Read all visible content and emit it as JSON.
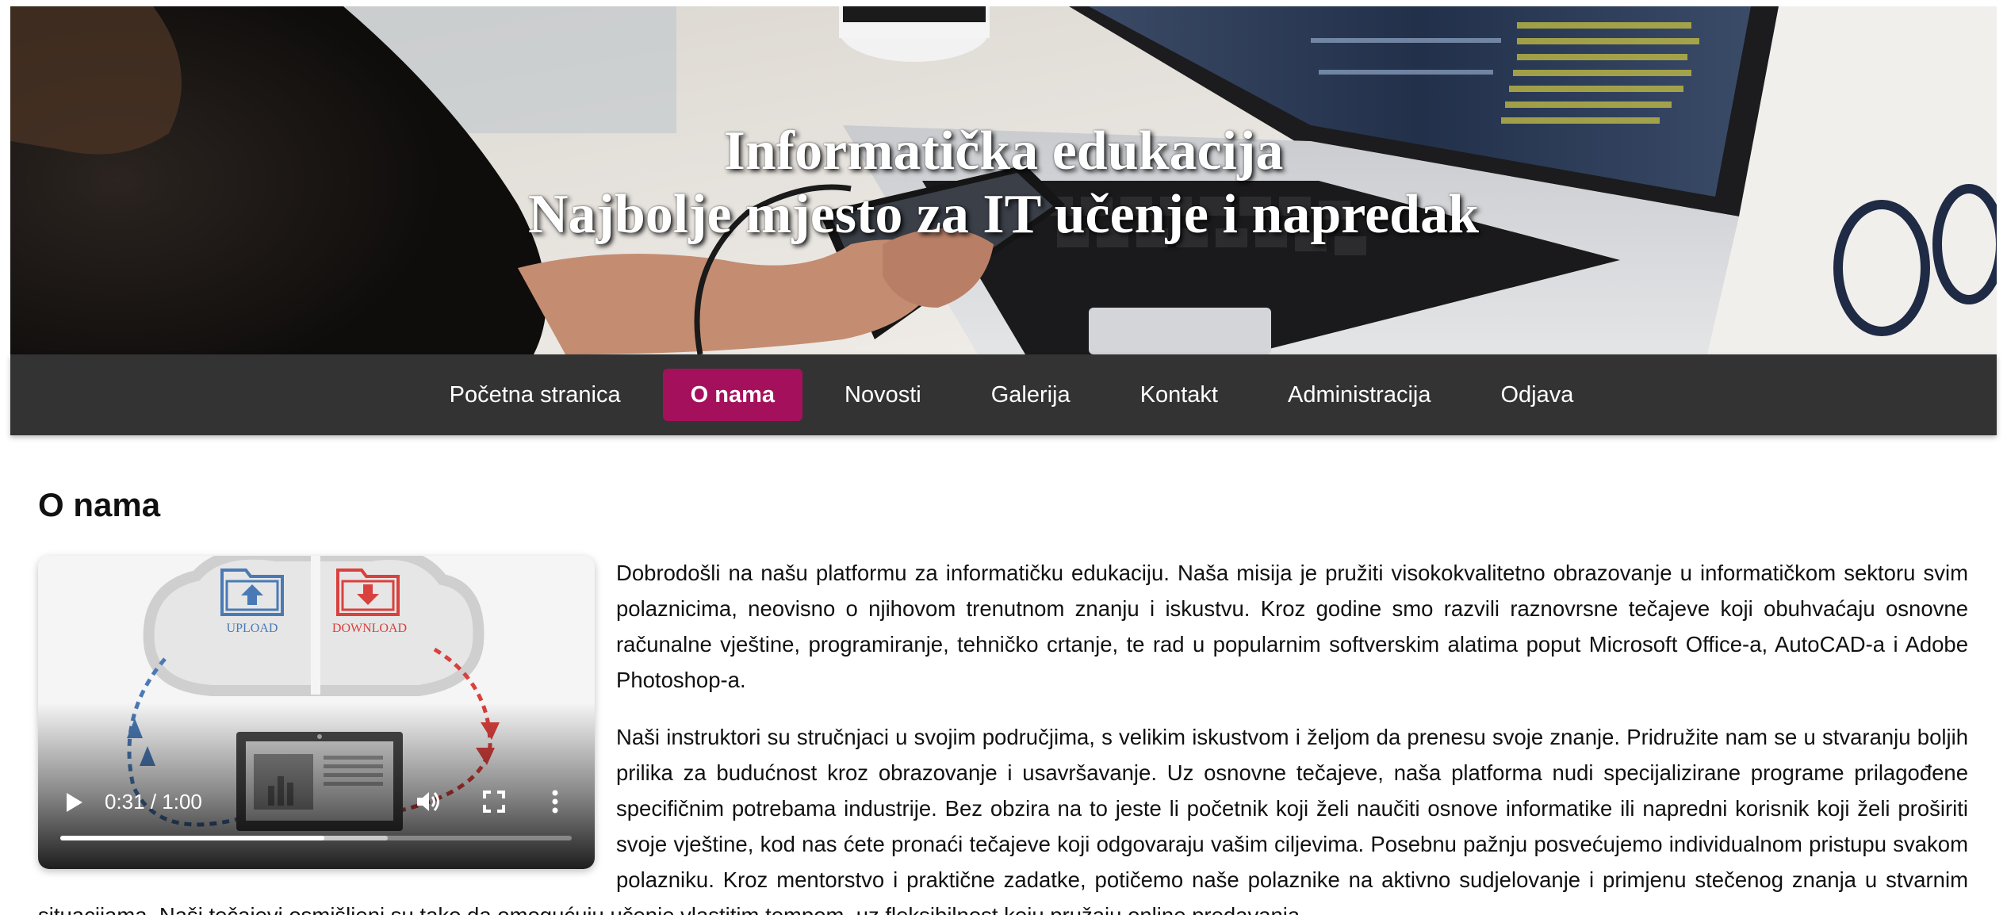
{
  "hero": {
    "title_line1": "Informatička edukacija",
    "title_line2": "Najbolje mjesto za IT učenje i napredak"
  },
  "nav": {
    "items": [
      {
        "label": "Početna stranica",
        "active": false
      },
      {
        "label": "O nama",
        "active": true
      },
      {
        "label": "Novosti",
        "active": false
      },
      {
        "label": "Galerija",
        "active": false
      },
      {
        "label": "Kontakt",
        "active": false
      },
      {
        "label": "Administracija",
        "active": false
      },
      {
        "label": "Odjava",
        "active": false
      }
    ],
    "active_color": "#a5105c",
    "background_color": "#333333"
  },
  "main": {
    "heading": "O nama",
    "video": {
      "time_display": "0:31 / 1:00",
      "progress_fraction": 0.5167,
      "buffered_fraction": 0.64,
      "upload_label": "UPLOAD",
      "download_label": "DOWNLOAD",
      "upload_color": "#4a7ab5",
      "download_color": "#d9413e",
      "icons": [
        "play-icon",
        "volume-icon",
        "fullscreen-icon",
        "more-options-icon"
      ]
    },
    "paragraph1": "Dobrodošli na našu platformu za informatičku edukaciju. Naša misija je pružiti visokokvalitetno obrazovanje u informatičkom sektoru svim polaznicima, neovisno o njihovom trenutnom znanju i iskustvu. Kroz godine smo razvili raznovrsne tečajeve koji obuhvaćaju osnovne računalne vještine, programiranje, tehničko crtanje, te rad u popularnim softverskim alatima poput Microsoft Office-a, AutoCAD-a i Adobe Photoshop-a.",
    "paragraph2": "Naši instruktori su stručnjaci u svojim područjima, s velikim iskustvom i željom da prenesu svoje znanje. Pridružite nam se u stvaranju boljih prilika za budućnost kroz obrazovanje i usavršavanje. Uz osnovne tečajeve, naša platforma nudi specijalizirane programe prilagođene specifičnim potrebama industrije. Bez obzira na to jeste li početnik koji želi naučiti osnove informatike ili napredni korisnik koji želi proširiti svoje vještine, kod nas ćete pronaći tečajeve koji odgovaraju vašim ciljevima. Posebnu pažnju posvećujemo individualnom pristupu svakom polazniku. Kroz mentorstvo i praktične zadatke, potičemo naše polaznike na aktivno sudjelovanje i primjenu stečenog znanja u stvarnim situacijama. Naši tečajevi osmišljeni su tako da omogućuju učenje vlastitim tempom, uz fleksibilnost koju pružaju online predavanja."
  }
}
